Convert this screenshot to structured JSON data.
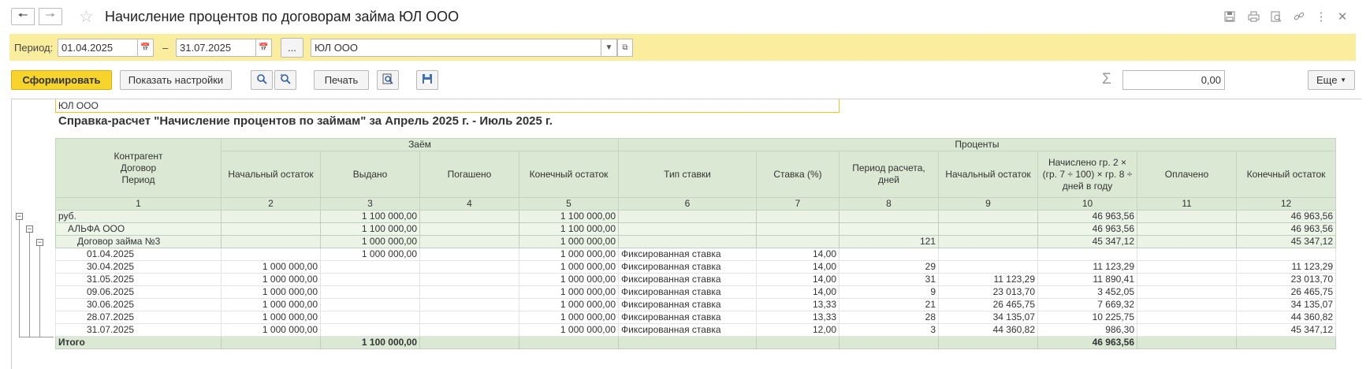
{
  "window": {
    "title": "Начисление процентов по договорам займа ЮЛ ООО"
  },
  "period": {
    "label": "Период:",
    "from": "01.04.2025",
    "dash": "–",
    "to": "31.07.2025",
    "more": "...",
    "org": "ЮЛ ООО"
  },
  "toolbar": {
    "generate": "Сформировать",
    "show_settings": "Показать настройки",
    "print": "Печать",
    "sum_value": "0,00",
    "more": "Еще"
  },
  "report": {
    "org": "ЮЛ ООО",
    "title": "Справка-расчет \"Начисление процентов по займам\" за Апрель 2025 г. - Июль 2025 г.",
    "group_loan": "Заём",
    "group_interest": "Проценты",
    "columns": [
      "Контрагент\nДоговор\nПериод",
      "Начальный остаток",
      "Выдано",
      "Погашено",
      "Конечный остаток",
      "Тип ставки",
      "Ставка (%)",
      "Период расчета, дней",
      "Начальный остаток",
      "Начислено гр. 2 × (гр. 7 ÷ 100) × гр. 8 ÷ дней в году",
      "Оплачено",
      "Конечный остаток"
    ],
    "numbers": [
      "1",
      "2",
      "3",
      "4",
      "5",
      "6",
      "7",
      "8",
      "9",
      "10",
      "11",
      "12"
    ],
    "rows": [
      {
        "c": [
          "руб.",
          "",
          "1 100 000,00",
          "",
          "1 100 000,00",
          "",
          "",
          "",
          "",
          "46 963,56",
          "",
          "46 963,56"
        ]
      },
      {
        "c": [
          "АЛЬФА ООО",
          "",
          "1 100 000,00",
          "",
          "1 100 000,00",
          "",
          "",
          "",
          "",
          "46 963,56",
          "",
          "46 963,56"
        ]
      },
      {
        "c": [
          "Договор займа №3",
          "",
          "1 000 000,00",
          "",
          "1 000 000,00",
          "",
          "",
          "121",
          "",
          "45 347,12",
          "",
          "45 347,12"
        ]
      },
      {
        "c": [
          "01.04.2025",
          "",
          "1 000 000,00",
          "",
          "1 000 000,00",
          "Фиксированная ставка",
          "14,00",
          "",
          "",
          "",
          "",
          ""
        ]
      },
      {
        "c": [
          "30.04.2025",
          "1 000 000,00",
          "",
          "",
          "1 000 000,00",
          "Фиксированная ставка",
          "14,00",
          "29",
          "",
          "11 123,29",
          "",
          "11 123,29"
        ]
      },
      {
        "c": [
          "31.05.2025",
          "1 000 000,00",
          "",
          "",
          "1 000 000,00",
          "Фиксированная ставка",
          "14,00",
          "31",
          "11 123,29",
          "11 890,41",
          "",
          "23 013,70"
        ]
      },
      {
        "c": [
          "09.06.2025",
          "1 000 000,00",
          "",
          "",
          "1 000 000,00",
          "Фиксированная ставка",
          "14,00",
          "9",
          "23 013,70",
          "3 452,05",
          "",
          "26 465,75"
        ]
      },
      {
        "c": [
          "30.06.2025",
          "1 000 000,00",
          "",
          "",
          "1 000 000,00",
          "Фиксированная ставка",
          "13,33",
          "21",
          "26 465,75",
          "7 669,32",
          "",
          "34 135,07"
        ]
      },
      {
        "c": [
          "28.07.2025",
          "1 000 000,00",
          "",
          "",
          "1 000 000,00",
          "Фиксированная ставка",
          "13,33",
          "28",
          "34 135,07",
          "10 225,75",
          "",
          "44 360,82"
        ]
      },
      {
        "c": [
          "31.07.2025",
          "1 000 000,00",
          "",
          "",
          "1 000 000,00",
          "Фиксированная ставка",
          "12,00",
          "3",
          "44 360,82",
          "986,30",
          "",
          "45 347,12"
        ]
      }
    ],
    "total": [
      "Итого",
      "",
      "1 100 000,00",
      "",
      "",
      "",
      "",
      "",
      "",
      "46 963,56",
      "",
      ""
    ]
  },
  "icons": {
    "back": "arrow-left",
    "forward": "arrow-right",
    "favorite": "star",
    "calendar": "calendar",
    "dropdown": "chevron-down",
    "open": "open-window",
    "search": "magnifier",
    "search_settings": "magnifier-settings",
    "preview": "print-preview",
    "save": "floppy-disk",
    "sigma": "sigma",
    "window_tools": [
      "save",
      "print",
      "preview",
      "link",
      "more-vertical",
      "close"
    ]
  },
  "colors": {
    "accent_band": "#fbed9e",
    "primary_button": "#f7d42b",
    "header_green": "#dbe9d4"
  }
}
